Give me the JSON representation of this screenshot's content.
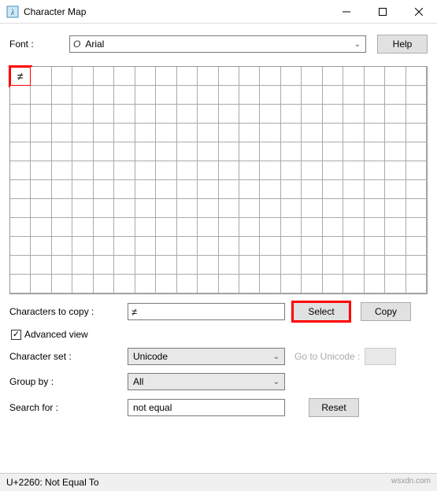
{
  "window": {
    "title": "Character Map"
  },
  "font": {
    "label": "Font :",
    "value": "Arial",
    "help_label": "Help"
  },
  "grid": {
    "rows": 12,
    "cols": 20,
    "selected_char": "≠",
    "selected_index": 0
  },
  "copy": {
    "label": "Characters to copy :",
    "value": "≠",
    "select_label": "Select",
    "copy_label": "Copy"
  },
  "advanced": {
    "checkbox_label": "Advanced view",
    "checked": true
  },
  "charset": {
    "label": "Character set :",
    "value": "Unicode",
    "gounicode_label": "Go to Unicode :",
    "gounicode_value": ""
  },
  "groupby": {
    "label": "Group by :",
    "value": "All"
  },
  "search": {
    "label": "Search for :",
    "value": "not equal",
    "reset_label": "Reset"
  },
  "status": {
    "text": "U+2260: Not Equal To"
  },
  "watermark": "wsxdn.com"
}
